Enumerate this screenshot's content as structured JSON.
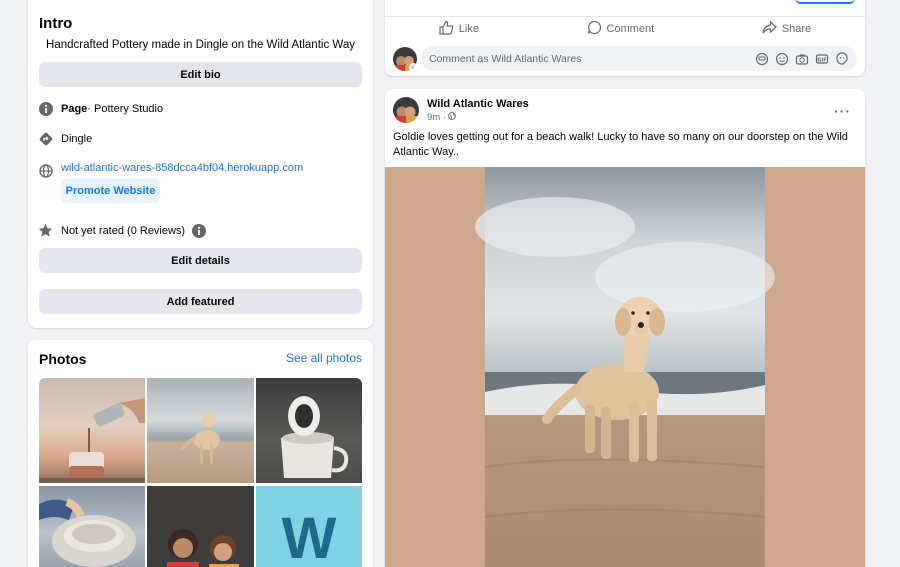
{
  "intro": {
    "title": "Intro",
    "bio": "Handcrafted Pottery made in Dingle on the Wild Atlantic Way",
    "edit_bio_label": "Edit bio",
    "category_prefix": "Page",
    "category": " · Pottery Studio",
    "location": "Dingle",
    "website": "wild-atlantic-wares-858dcca4bf04.herokuapp.com",
    "promote_label": "Promote Website",
    "rating": "Not yet rated (0 Reviews)",
    "edit_details_label": "Edit details",
    "add_featured_label": "Add featured"
  },
  "photos": {
    "title": "Photos",
    "see_all_label": "See all photos",
    "items": [
      "pouring-jug-photo",
      "dog-on-beach-photo",
      "stacked-mugs-photo",
      "pottery-wheel-photo",
      "two-people-photo",
      "w-logo-photo"
    ],
    "logo_letter": "W"
  },
  "actions": {
    "like_label": "Like",
    "comment_label": "Comment",
    "share_label": "Share",
    "comment_placeholder": "Comment as Wild Atlantic Wares"
  },
  "post": {
    "author": "Wild Atlantic Wares",
    "time": "9m ·",
    "more_label": "···",
    "text": "Goldie loves getting out for a beach walk! Lucky to have so many on our doorstep on the Wild Atlantic Way.."
  },
  "colors": {
    "link": "#216fdb",
    "accent": "#1877f2",
    "button_grey": "#e4e6eb",
    "page_bg": "#f0f2f5",
    "logo_tile": "#7fd3e3"
  }
}
